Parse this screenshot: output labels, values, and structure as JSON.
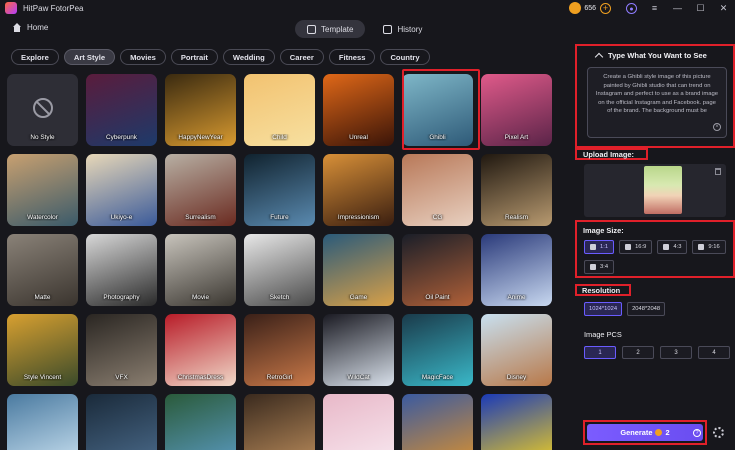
{
  "app": {
    "title": "HitPaw FotorPea",
    "credits": "656"
  },
  "window_controls": [
    "—",
    "☐",
    "✕"
  ],
  "nav": {
    "home": "Home",
    "tabs": [
      {
        "label": "Template",
        "active": true
      },
      {
        "label": "History",
        "active": false
      }
    ]
  },
  "categories": [
    {
      "label": "Explore",
      "active": false
    },
    {
      "label": "Art Style",
      "active": true
    },
    {
      "label": "Movies",
      "active": false
    },
    {
      "label": "Portrait",
      "active": false
    },
    {
      "label": "Wedding",
      "active": false
    },
    {
      "label": "Career",
      "active": false
    },
    {
      "label": "Fitness",
      "active": false
    },
    {
      "label": "Country",
      "active": false
    }
  ],
  "styles": [
    {
      "label": "No Style",
      "colors": [
        "#2e2e36",
        "#2e2e36"
      ],
      "selected": false
    },
    {
      "label": "Cyberpunk",
      "colors": [
        "#5a1c3c",
        "#1d3a6a"
      ],
      "selected": false
    },
    {
      "label": "HappyNewYear",
      "colors": [
        "#3a2a10",
        "#d89a30"
      ],
      "selected": false
    },
    {
      "label": "Child",
      "colors": [
        "#f2c270",
        "#f7e0a0"
      ],
      "selected": false
    },
    {
      "label": "Unreal",
      "colors": [
        "#e06818",
        "#3a1408"
      ],
      "selected": false
    },
    {
      "label": "Ghibli",
      "colors": [
        "#7fb7c8",
        "#2e5a78"
      ],
      "selected": true
    },
    {
      "label": "Pixel Art",
      "colors": [
        "#e05a8a",
        "#5a2448"
      ],
      "selected": false
    },
    {
      "label": "Watercolor",
      "colors": [
        "#c8a070",
        "#3a5a6a"
      ],
      "selected": false
    },
    {
      "label": "Ukiyo-e",
      "colors": [
        "#e8d8b8",
        "#3a5a9a"
      ],
      "selected": false
    },
    {
      "label": "Surrealism",
      "colors": [
        "#b8b0a4",
        "#6a2a20"
      ],
      "selected": false
    },
    {
      "label": "Future",
      "colors": [
        "#10222e",
        "#5a8ab0"
      ],
      "selected": false
    },
    {
      "label": "Impressionism",
      "colors": [
        "#d89038",
        "#3a1e10"
      ],
      "selected": false
    },
    {
      "label": "CG",
      "colors": [
        "#b87858",
        "#e8d0c0"
      ],
      "selected": false
    },
    {
      "label": "Realism",
      "colors": [
        "#201810",
        "#b89a70"
      ],
      "selected": false
    },
    {
      "label": "Matte",
      "colors": [
        "#8a8278",
        "#3a342e"
      ],
      "selected": false
    },
    {
      "label": "Photography",
      "colors": [
        "#d8d8d8",
        "#2a2a2a"
      ],
      "selected": false
    },
    {
      "label": "Movie",
      "colors": [
        "#c8c4bc",
        "#3a3630"
      ],
      "selected": false
    },
    {
      "label": "Sketch",
      "colors": [
        "#e8e8e8",
        "#4a4a4a"
      ],
      "selected": false
    },
    {
      "label": "Game",
      "colors": [
        "#2a5a7a",
        "#d8a048"
      ],
      "selected": false
    },
    {
      "label": "Oil Paint",
      "colors": [
        "#1a1e28",
        "#b06038"
      ],
      "selected": false
    },
    {
      "label": "Anime",
      "colors": [
        "#2a3a7a",
        "#c8d8f0"
      ],
      "selected": false
    },
    {
      "label": "Style Vincent",
      "colors": [
        "#d8a030",
        "#3a4a2a"
      ],
      "selected": false
    },
    {
      "label": "VFX",
      "colors": [
        "#2a2622",
        "#8a7e70"
      ],
      "selected": false
    },
    {
      "label": "ChristmasDress",
      "colors": [
        "#b81c28",
        "#f0d8c8"
      ],
      "selected": false
    },
    {
      "label": "RetroGirl",
      "colors": [
        "#3a2018",
        "#c87848"
      ],
      "selected": false
    },
    {
      "label": "WildCat",
      "colors": [
        "#1a1a22",
        "#d8e0ea"
      ],
      "selected": false
    },
    {
      "label": "MagicFace",
      "colors": [
        "#1a3a4a",
        "#3ab8c8"
      ],
      "selected": false
    },
    {
      "label": "Disney",
      "colors": [
        "#c8e0f0",
        "#b87848"
      ],
      "selected": false
    },
    {
      "label": "",
      "colors": [
        "#4a7aa0",
        "#c8e0f0"
      ],
      "selected": false
    },
    {
      "label": "",
      "colors": [
        "#1a2a3a",
        "#4a6a8a"
      ],
      "selected": false
    },
    {
      "label": "",
      "colors": [
        "#2a5a3a",
        "#5a9ac0"
      ],
      "selected": false
    },
    {
      "label": "",
      "colors": [
        "#3a2a1e",
        "#b88a5a"
      ],
      "selected": false
    },
    {
      "label": "",
      "colors": [
        "#e8b8c8",
        "#f8e8f0"
      ],
      "selected": false
    },
    {
      "label": "",
      "colors": [
        "#3a5aa0",
        "#d89030"
      ],
      "selected": false
    },
    {
      "label": "",
      "colors": [
        "#1a3ab8",
        "#f0d020"
      ],
      "selected": false
    }
  ],
  "panel": {
    "prompt_title": "Type What You Want to See",
    "prompt_text": "Create a Ghibli style image of this picture painted by Ghibli studio that can trend on Instagram and perfect to use as a brand image on the official Instagram and Facebook. page of the brand. The background must be",
    "upload_label": "Upload Image:",
    "image_size_label": "Image Size:",
    "sizes": [
      {
        "label": "1:1",
        "active": true
      },
      {
        "label": "16:9",
        "active": false
      },
      {
        "label": "4:3",
        "active": false
      },
      {
        "label": "9:16",
        "active": false
      },
      {
        "label": "3:4",
        "active": false
      }
    ],
    "resolution_label": "Resolution",
    "resolutions": [
      {
        "label": "1024*1024",
        "active": true
      },
      {
        "label": "2048*2048",
        "active": false
      }
    ],
    "pcs_label": "Image PCS",
    "pcs": [
      {
        "label": "1",
        "active": true
      },
      {
        "label": "2",
        "active": false
      },
      {
        "label": "3",
        "active": false
      },
      {
        "label": "4",
        "active": false
      }
    ],
    "generate_label": "Generate",
    "generate_cost": "2"
  },
  "colors": {
    "accent": "#6a4df0",
    "highlight": "#e0202a",
    "coin": "#f0a020"
  }
}
